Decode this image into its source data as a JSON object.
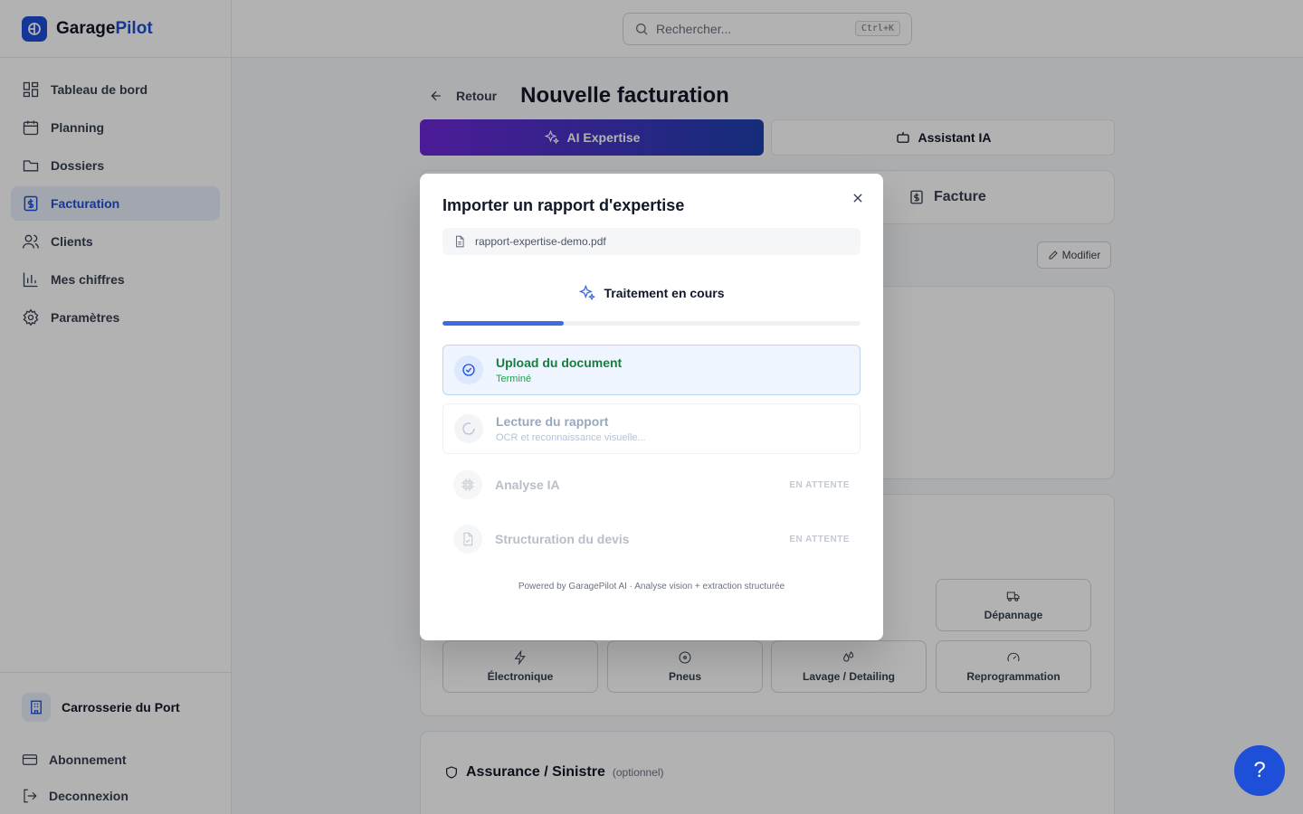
{
  "app": {
    "brand_main": "Garage",
    "brand_accent": "Pilot",
    "accent_color": "#1e4fd8"
  },
  "search": {
    "placeholder": "Rechercher...",
    "shortcut": "Ctrl+K"
  },
  "sidebar": {
    "items": [
      {
        "label": "Tableau de bord",
        "icon": "dashboard-icon"
      },
      {
        "label": "Planning",
        "icon": "calendar-icon"
      },
      {
        "label": "Dossiers",
        "icon": "folder-icon"
      },
      {
        "label": "Facturation",
        "icon": "dollar-file-icon",
        "active": true
      },
      {
        "label": "Clients",
        "icon": "users-icon"
      },
      {
        "label": "Mes chiffres",
        "icon": "bar-chart-icon"
      },
      {
        "label": "Paramètres",
        "icon": "gear-icon"
      }
    ],
    "shop_name": "Carrosserie du Port",
    "subscription": "Abonnement",
    "logout": "Deconnexion"
  },
  "header": {
    "back_label": "Retour",
    "title": "Nouvelle facturation"
  },
  "modes": {
    "ai_expertise": "AI Expertise",
    "assistant": "Assistant IA"
  },
  "tabs": {
    "facture": "Facture"
  },
  "modify_label": "Modifier",
  "services": [
    "Dépannage",
    "Électronique",
    "Pneus",
    "Lavage / Detailing",
    "Reprogrammation"
  ],
  "insurance": {
    "title": "Assurance / Sinistre",
    "optional": "(optionnel)"
  },
  "modal": {
    "title": "Importer un rapport d'expertise",
    "file_name": "rapport-expertise-demo.pdf",
    "processing_label": "Traitement en cours",
    "progress_fraction": 0.29,
    "steps": [
      {
        "name": "Upload du document",
        "sub": "Terminé",
        "status": "done"
      },
      {
        "name": "Lecture du rapport",
        "sub": "OCR et reconnaissance visuelle...",
        "status": "active"
      },
      {
        "name": "Analyse IA",
        "status_label": "EN ATTENTE"
      },
      {
        "name": "Structuration du devis",
        "status_label": "EN ATTENTE"
      }
    ],
    "footer": "Powered by GaragePilot AI · Analyse vision + extraction structurée"
  },
  "help_label": "?"
}
